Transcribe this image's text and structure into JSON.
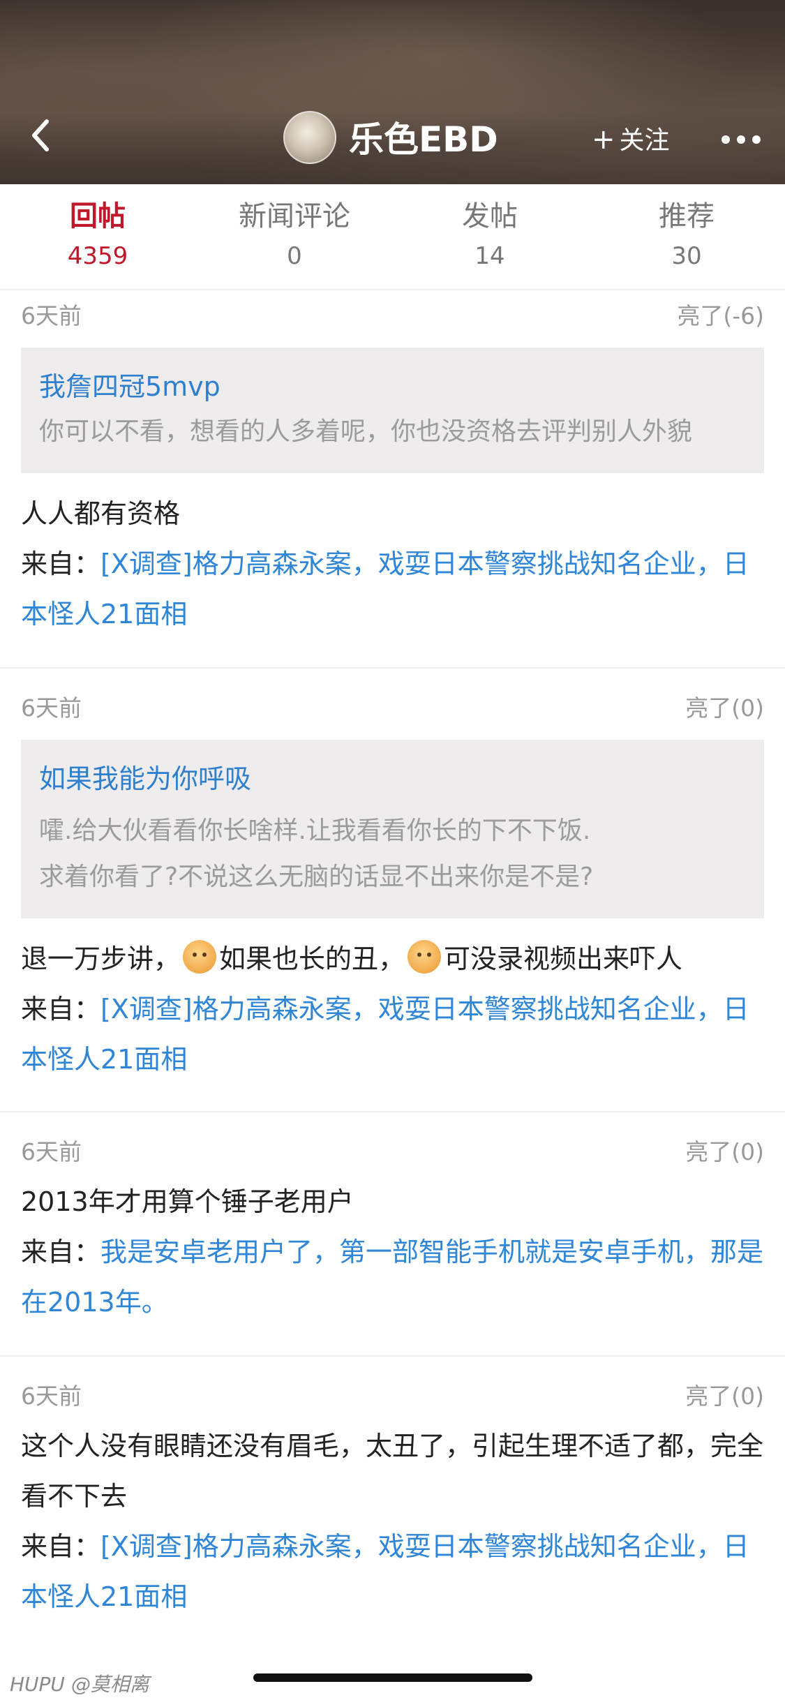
{
  "header": {
    "username": "乐色EBD",
    "follow_label": "关注",
    "back_icon": "chevron-left-icon",
    "more_icon": "ellipsis-icon"
  },
  "tabs": [
    {
      "label": "回帖",
      "count": "4359",
      "active": true
    },
    {
      "label": "新闻评论",
      "count": "0",
      "active": false
    },
    {
      "label": "发帖",
      "count": "14",
      "active": false
    },
    {
      "label": "推荐",
      "count": "30",
      "active": false
    }
  ],
  "posts": [
    {
      "time": "6天前",
      "likes": "亮了(-6)",
      "quote": {
        "author": "我詹四冠5mvp",
        "text": "你可以不看，想看的人多着呢，你也没资格去评判别人外貌"
      },
      "body": "人人都有资格",
      "source_prefix": "来自：",
      "source_title": "[X调查]格力高森永案，戏耍日本警察挑战知名企业，日本怪人21面相"
    },
    {
      "time": "6天前",
      "likes": "亮了(0)",
      "quote": {
        "author": "如果我能为你呼吸",
        "text_line1": "嚯.给大伙看看你长啥样.让我看看你长的下不下饭.",
        "text_line2": "求着你看了?不说这么无脑的话显不出来你是不是?"
      },
      "body_part1": "退一万步讲，",
      "body_part2": "如果也长的丑，",
      "body_part3": "可没录视频出来吓人",
      "emoji_icon": "emoji-face-icon",
      "source_prefix": "来自：",
      "source_title": "[X调查]格力高森永案，戏耍日本警察挑战知名企业，日本怪人21面相"
    },
    {
      "time": "6天前",
      "likes": "亮了(0)",
      "body": "2013年才用算个锤子老用户",
      "source_prefix": "来自：",
      "source_title": "我是安卓老用户了，第一部智能手机就是安卓手机，那是在2013年。"
    },
    {
      "time": "6天前",
      "likes": "亮了(0)",
      "body": "这个人没有眼睛还没有眉毛，太丑了，引起生理不适了都，完全看不下去",
      "source_prefix": "来自：",
      "source_title": "[X调查]格力高森永案，戏耍日本警察挑战知名企业，日本怪人21面相"
    }
  ],
  "footer": {
    "watermark": "HUPU @莫相离"
  }
}
